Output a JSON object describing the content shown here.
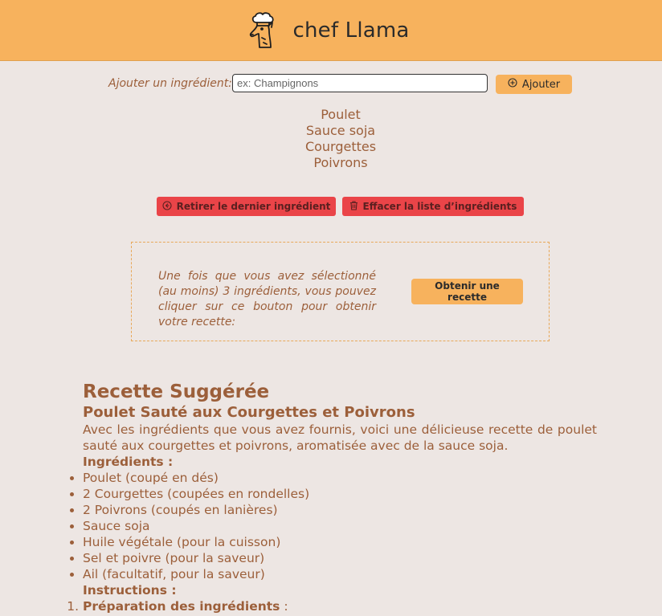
{
  "header": {
    "title": "chef Llama",
    "logo_icon": "chef-llama-icon",
    "background": "#f7b25d"
  },
  "add_form": {
    "label": "Ajouter un ingrédient:",
    "input_value": "",
    "input_placeholder": "ex: Champignons",
    "button_label": "Ajouter",
    "button_icon": "plus-circle-icon"
  },
  "ingredients": [
    "Poulet",
    "Sauce soja",
    "Courgettes",
    "Poivrons"
  ],
  "actions": {
    "remove_last_label": "Retirer le dernier ingrédient",
    "remove_last_icon": "arrow-left-circle-icon",
    "clear_label": "Effacer la liste d’ingrédients",
    "clear_icon": "trash-icon",
    "danger_color": "#ea4448"
  },
  "recipe_prompt": {
    "hint": "Une fois que vous avez sélectionné (au moins) 3 ingrédients, vous pouvez cliquer sur ce bouton pour obtenir votre recette:",
    "button_label": "Obtenir une recette"
  },
  "recipe": {
    "heading": "Recette Suggérée",
    "title": "Poulet Sauté aux Courgettes et Poivrons",
    "intro": "Avec les ingrédients que vous avez fournis, voici une délicieuse recette de poulet sauté aux courgettes et poivrons, aromatisée avec de la sauce soja.",
    "ingredients_heading": "Ingrédients :",
    "ingredients": [
      "Poulet (coupé en dés)",
      "2 Courgettes (coupées en rondelles)",
      "2 Poivrons (coupés en lanières)",
      "Sauce soja",
      "Huile végétale (pour la cuisson)",
      "Sel et poivre (pour la saveur)",
      "Ail (facultatif, pour la saveur)"
    ],
    "instructions_heading": "Instructions :",
    "steps": [
      {
        "title": "Préparation des ingrédients",
        "suffix": " :"
      }
    ]
  }
}
